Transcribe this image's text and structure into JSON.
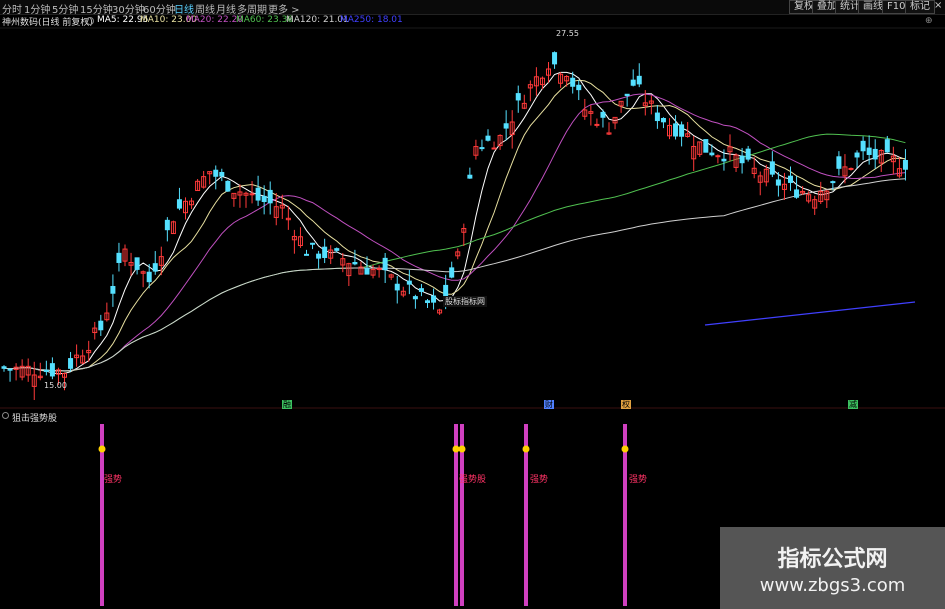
{
  "toolbar": {
    "tabs": [
      "分时",
      "1分钟",
      "5分钟",
      "15分钟",
      "30分钟",
      "60分钟",
      "日线",
      "周线",
      "月线",
      "多周期",
      "更多 >"
    ],
    "active_tab": "日线",
    "right_buttons": [
      "复权",
      "叠加",
      "统计",
      "画线",
      "F10",
      "标记"
    ]
  },
  "title": {
    "stock": "神州数码(日线 前复权)",
    "ma": [
      {
        "label": "MA5: 22.95",
        "color": "#ffffff"
      },
      {
        "label": "MA10: 23.00",
        "color": "#e8e0a0"
      },
      {
        "label": "MA20: 22.20",
        "color": "#c050c0"
      },
      {
        "label": "MA60: 23.36",
        "color": "#50c050"
      },
      {
        "label": "MA120: 21.01",
        "color": "#d0d0d0"
      },
      {
        "label": "MA250: 18.01",
        "color": "#4040ff"
      }
    ]
  },
  "annotations": {
    "high_price": "27.55",
    "low_price": "15.00",
    "center_tag": "股标指标网"
  },
  "flags": [
    {
      "char": "融",
      "color": "#3cc060"
    },
    {
      "char": "财",
      "color": "#5080ff"
    },
    {
      "char": "权",
      "color": "#e0a040"
    },
    {
      "char": "减",
      "color": "#3cc060"
    }
  ],
  "indicator": {
    "title": "狙击强势股",
    "signal_label": "强势股",
    "signal_label_short": "强势"
  },
  "watermark": {
    "title": "指标公式网",
    "url": "www.zbgs3.com"
  },
  "chart_data": {
    "type": "candlestick",
    "title": "",
    "price_range": [
      15.0,
      27.55
    ],
    "series": [
      {
        "name": "MA5",
        "color": "#ffffff"
      },
      {
        "name": "MA10",
        "color": "#e8e0a0"
      },
      {
        "name": "MA20",
        "color": "#c050c0"
      },
      {
        "name": "MA60",
        "color": "#50c050"
      },
      {
        "name": "MA120",
        "color": "#d0d0d0"
      },
      {
        "name": "MA250",
        "color": "#4040ff"
      }
    ],
    "signals": [
      {
        "label": "强势股"
      },
      {
        "label": "强势股"
      },
      {
        "label": "强势股"
      },
      {
        "label": "强势股"
      },
      {
        "label": "强势股"
      }
    ]
  }
}
